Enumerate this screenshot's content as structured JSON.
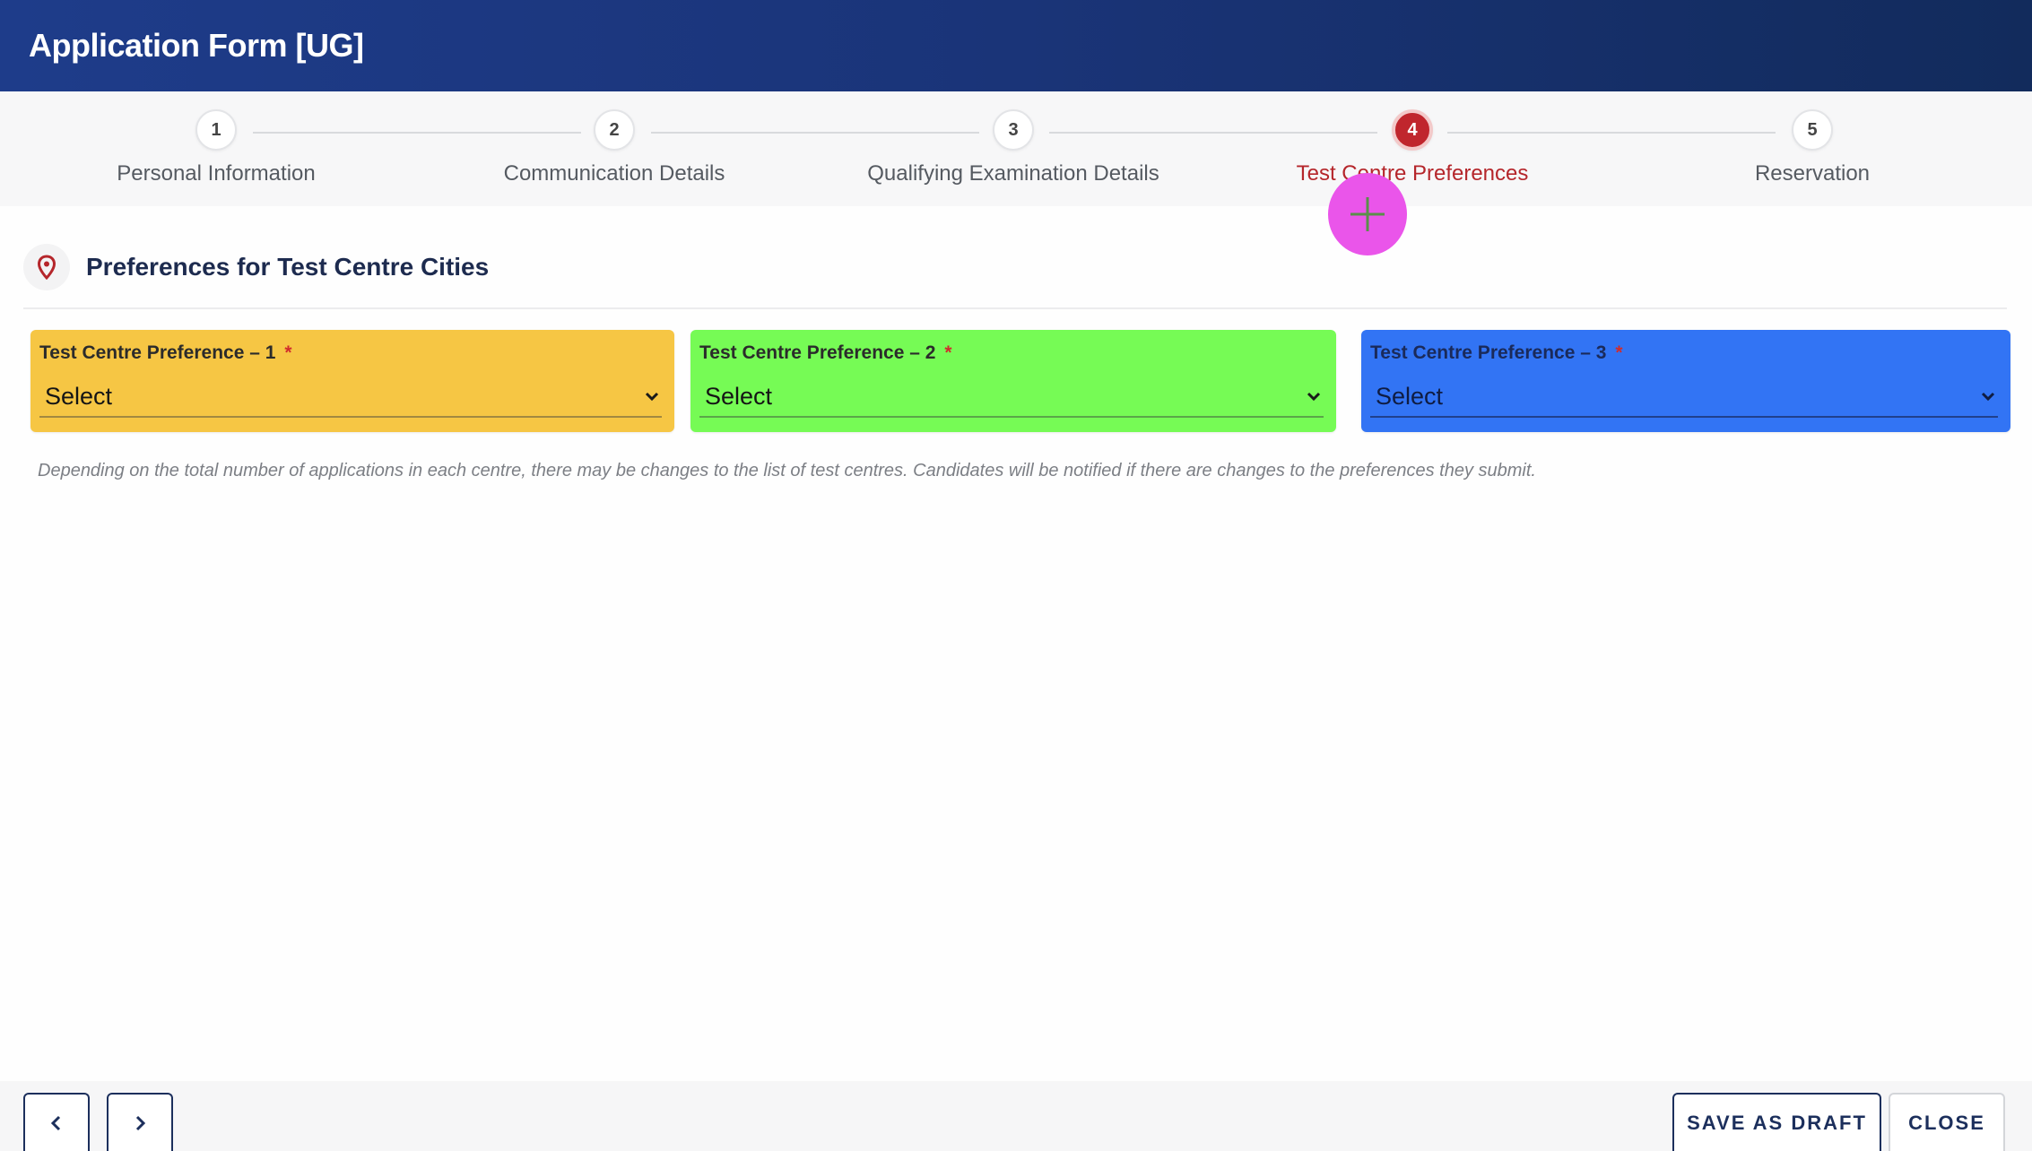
{
  "header": {
    "title": "Application Form [UG]"
  },
  "stepper": {
    "active_step": 4,
    "steps": [
      {
        "number": "1",
        "label": "Personal Information"
      },
      {
        "number": "2",
        "label": "Communication Details"
      },
      {
        "number": "3",
        "label": "Qualifying Examination Details"
      },
      {
        "number": "4",
        "label": "Test Centre Preferences"
      },
      {
        "number": "5",
        "label": "Reservation"
      }
    ]
  },
  "section": {
    "title": "Preferences for Test Centre Cities",
    "icon": "map-pin-icon"
  },
  "preferences": [
    {
      "label": "Test Centre Preference – 1",
      "required_mark": "*",
      "value": "Select",
      "color": "#f6c644"
    },
    {
      "label": "Test Centre Preference – 2",
      "required_mark": "*",
      "value": "Select",
      "color": "#76fb55"
    },
    {
      "label": "Test Centre Preference – 3",
      "required_mark": "*",
      "value": "Select",
      "color": "#3274f4"
    }
  ],
  "note": "Depending on the total number of applications in each centre, there may be changes to the list of test centres. Candidates will be notified if there are changes to the preferences they submit.",
  "footer": {
    "prev_icon": "chevron-left-icon",
    "next_icon": "chevron-right-icon",
    "save_draft_label": "SAVE AS DRAFT",
    "close_label": "CLOSE"
  },
  "colors": {
    "header": "#1e3c8a",
    "active_step": "#c0262d",
    "click_indicator": "#ea55ea"
  }
}
